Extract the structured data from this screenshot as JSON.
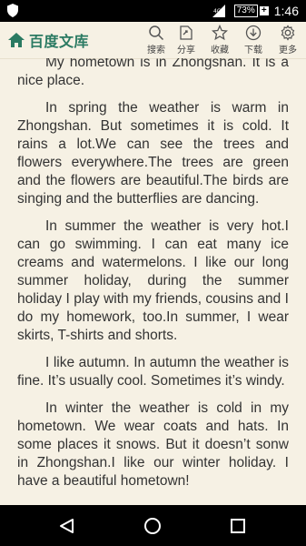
{
  "status_bar": {
    "battery": "73%",
    "time": "1:46"
  },
  "app_bar": {
    "brand": "百度文库",
    "actions": [
      {
        "label": "搜索",
        "icon": "search-icon"
      },
      {
        "label": "分享",
        "icon": "share-icon"
      },
      {
        "label": "收藏",
        "icon": "star-icon"
      },
      {
        "label": "下载",
        "icon": "download-icon"
      },
      {
        "label": "更多",
        "icon": "gear-icon"
      }
    ]
  },
  "document": {
    "paragraphs": [
      "My hometown is in Zhongshan. It is a nice place.",
      "In spring the weather is warm in Zhongshan. But sometimes it is cold. It rains a lot.We can see the trees and flowers everywhere.The trees are green and the flowers are beautiful.The birds are singing and the butterflies are dancing.",
      "In summer the weather is very hot.I can go swimming. I can eat many ice creams and watermelons. I like our long summer holiday, during the summer holiday I play with my friends, cousins and I do my homework, too.In summer, I wear skirts, T-shirts and shorts.",
      "I like autumn. In autumn the weather is fine. It’s usually cool. Sometimes it’s windy.",
      "In winter the weather is cold in my hometown. We wear coats and hats. In some places it snows. But it doesn’t sonw in Zhongshan.I like our winter holiday. I have a beautiful hometown!"
    ]
  },
  "nav_bar": {
    "buttons": [
      "back-icon",
      "home-icon",
      "recents-icon"
    ]
  },
  "colors": {
    "page_bg": "#f6f1e4",
    "brand": "#2a7a62",
    "text": "#333333"
  }
}
